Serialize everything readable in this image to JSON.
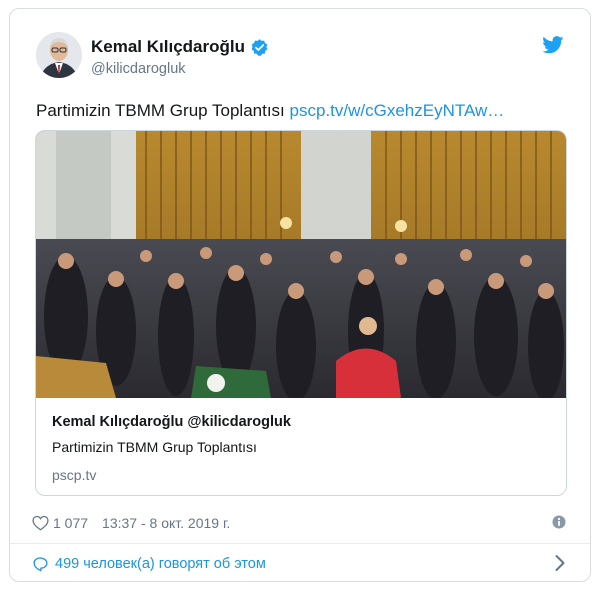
{
  "author": {
    "name": "Kemal Kılıçdaroğlu",
    "handle": "@kilicdarogluk"
  },
  "tweet": {
    "text": "Partimizin TBMM Grup Toplantısı",
    "link": "pscp.tv/w/cGxehzEyNTAw…"
  },
  "card": {
    "title": "Kemal Kılıçdaroğlu @kilicdarogluk",
    "description": "Partimizin TBMM Grup Toplantısı",
    "domain": "pscp.tv"
  },
  "meta": {
    "likes": "1 077",
    "timestamp": "13:37 - 8 окт. 2019 г."
  },
  "footer": {
    "talking": "499 человек(а) говорят об этом"
  },
  "colors": {
    "accent": "#1b95e0",
    "verified": "#1da1f2",
    "muted": "#657786"
  },
  "icons": [
    "verified-badge-icon",
    "twitter-bird-icon",
    "heart-icon",
    "info-icon",
    "comment-bubble-icon",
    "chevron-right-icon"
  ]
}
